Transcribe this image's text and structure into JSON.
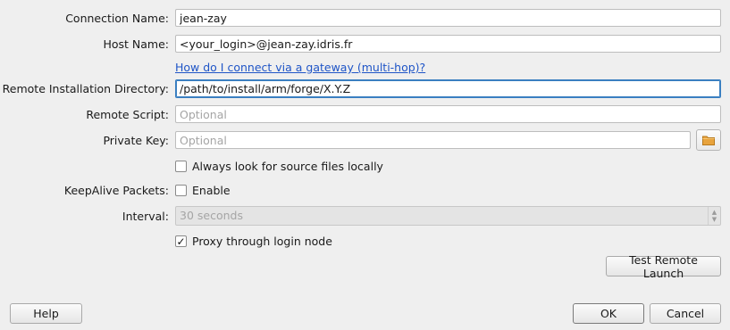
{
  "form": {
    "connection_name": {
      "label": "Connection Name:",
      "value": "jean-zay"
    },
    "host_name": {
      "label": "Host Name:",
      "value": "<your_login>@jean-zay.idris.fr"
    },
    "gateway_link": "How do I connect via a gateway (multi-hop)?",
    "remote_install_dir": {
      "label": "Remote Installation Directory:",
      "value": "/path/to/install/arm/forge/X.Y.Z"
    },
    "remote_script": {
      "label": "Remote Script:",
      "placeholder": "Optional"
    },
    "private_key": {
      "label": "Private Key:",
      "placeholder": "Optional"
    },
    "always_look_local": {
      "label": "Always look for source files locally",
      "checked": false
    },
    "keepalive": {
      "label": "KeepAlive Packets:",
      "checkbox_label": "Enable",
      "checked": false
    },
    "interval": {
      "label": "Interval:",
      "value": "30 seconds",
      "disabled": true
    },
    "proxy_login_node": {
      "label": "Proxy through login node",
      "checked": true
    },
    "test_remote_launch": "Test Remote Launch"
  },
  "footer": {
    "help": "Help",
    "ok": "OK",
    "cancel": "Cancel"
  },
  "icons": {
    "browse": "folder-icon",
    "spinner": "spinner-arrows-icon"
  },
  "colors": {
    "accent": "#3a7fc1",
    "link": "#1f55c7",
    "folder": "#e8a33d"
  }
}
